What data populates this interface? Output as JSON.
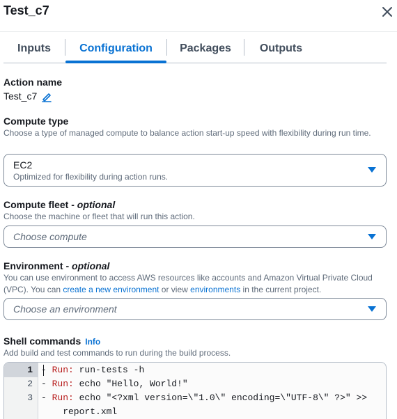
{
  "header": {
    "title": "Test_c7"
  },
  "tabs": [
    {
      "label": "Inputs"
    },
    {
      "label": "Configuration"
    },
    {
      "label": "Packages"
    },
    {
      "label": "Outputs"
    }
  ],
  "action_name": {
    "label": "Action name",
    "value": "Test_c7"
  },
  "compute_type": {
    "label": "Compute type",
    "description": "Choose a type of managed compute to balance action start-up speed with flexibility during run time.",
    "selected": "EC2",
    "selected_description": "Optimized for flexibility during action runs."
  },
  "compute_fleet": {
    "label": "Compute fleet - ",
    "optional": "optional",
    "description": "Choose the machine or fleet that will run this action.",
    "placeholder": "Choose compute"
  },
  "environment": {
    "label": "Environment - ",
    "optional": "optional",
    "desc_part1": "You can use environment to access AWS resources like accounts and Amazon Virtual Private Cloud (VPC). You can ",
    "desc_link1": "create a new environment",
    "desc_part2": " or view ",
    "desc_link2": "environments",
    "desc_part3": " in the current project.",
    "placeholder": "Choose an environment"
  },
  "shell_commands": {
    "label": "Shell commands",
    "info": "Info",
    "description": "Add build and test commands to run during the build process.",
    "lines": [
      {
        "no": "1",
        "dash": "- ",
        "key": "Run:",
        "rest": " run-tests -h"
      },
      {
        "no": "2",
        "dash": "- ",
        "key": "Run:",
        "rest": " echo \"Hello, World!\""
      },
      {
        "no": "3",
        "dash": "- ",
        "key": "Run:",
        "rest": " echo \"<?xml version=\\\"1.0\\\" encoding=\\\"UTF-8\\\" ?>\" >>"
      },
      {
        "no": "",
        "dash": "",
        "key": "",
        "rest": "    report.xml"
      }
    ]
  },
  "colors": {
    "accent": "#0972d3",
    "text": "#16191f",
    "muted": "#5f6b7a",
    "code_keyword": "#b71c1c"
  }
}
